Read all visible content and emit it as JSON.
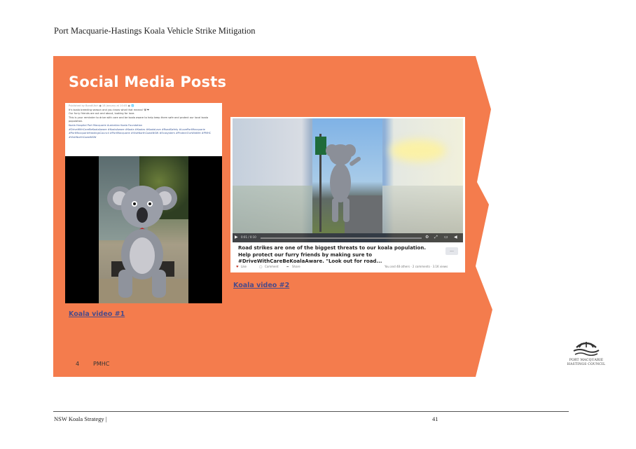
{
  "header": {
    "title": "Port Macquarie-Hastings Koala Vehicle Strike Mitigation"
  },
  "slide": {
    "title": "Social Media Posts",
    "background_color": "#f47c4d",
    "post1": {
      "meta": "Published by BondiUtch ● 18 January at 10:05 ● 🌐",
      "lines": [
        "It's koala breeding season and you know what that means! 🐨❤",
        "Our furry friends are out and about, looking for love.",
        "This is your reminder to drive with care and be koala aware to help keep them safe and protect our local koala population.",
        "Koala Hospital Port Macquarie  Australian Koala Foundation"
      ],
      "hashtags": "#DriveWithCareBeKoalaAware #KoalaAware #Koala #Koalas #KoalaLove #RoadSafety #LovePortMacquarie #PortMacquarieHastingsCouncil #PortMacquarie #VisitNorthCoastNSW #Ecosystem #ProtectOurWildlife #PMHC #VisitNorthCoastNSW"
    },
    "post2": {
      "time": "0:01 / 0:10",
      "caption": "Road strikes are one of the biggest threats to our koala population. Help protect our furry friends by making sure to #DriveWithCareBeKoalaAware. \"Look out for road...",
      "more": "...",
      "like": "Like",
      "comment": "Comment",
      "share": "Share",
      "reactions": "You and 48 others · 2 comments · 3.1K views"
    },
    "link1": "Koala video #1",
    "link2": "Koala video #2",
    "slide_number": "4",
    "org": "PMHC",
    "logo_text": [
      "PORT MACQUARIE",
      "HASTINGS COUNCIL"
    ]
  },
  "footer": {
    "left": "NSW Koala Strategy |",
    "page": "41"
  }
}
